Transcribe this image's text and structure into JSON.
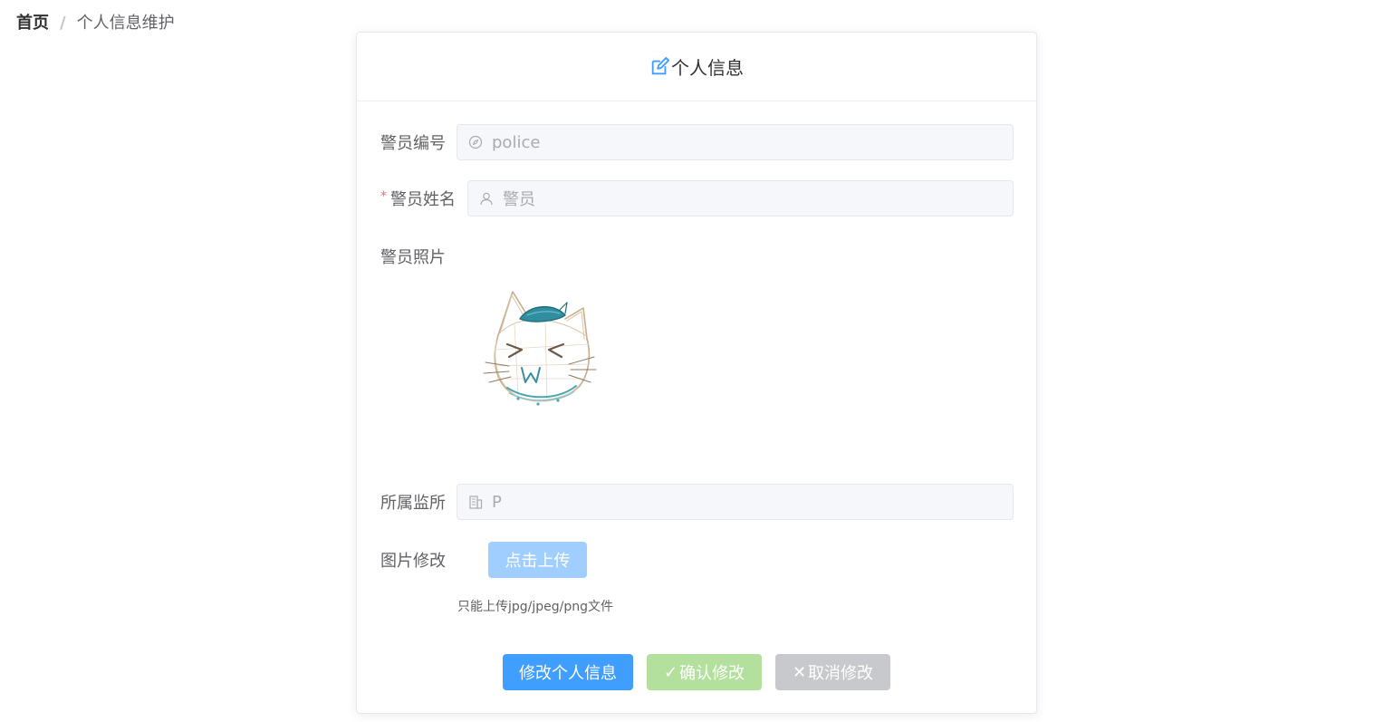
{
  "breadcrumb": {
    "home": "首页",
    "separator": "/",
    "current": "个人信息维护"
  },
  "card": {
    "title": "个人信息",
    "title_icon": "edit-icon"
  },
  "form": {
    "police_id": {
      "label": "警员编号",
      "value": "police",
      "icon": "compass-icon"
    },
    "police_name": {
      "label": "警员姓名",
      "required_mark": "*",
      "value": "警员",
      "icon": "user-icon"
    },
    "photo": {
      "label": "警员照片"
    },
    "station": {
      "label": "所属监所",
      "value": "P",
      "icon": "office-building-icon"
    },
    "image_edit": {
      "label": "图片修改",
      "upload_label": "点击上传",
      "tip": "只能上传jpg/jpeg/png文件"
    }
  },
  "actions": {
    "edit_label": "修改个人信息",
    "confirm_glyph": "✓",
    "confirm_label": "确认修改",
    "cancel_glyph": "✕",
    "cancel_label": "取消修改"
  },
  "colors": {
    "primary": "#409eff",
    "success_disabled": "#b3e19d",
    "info_disabled": "#c8c9cc",
    "danger": "#f56c6c"
  }
}
